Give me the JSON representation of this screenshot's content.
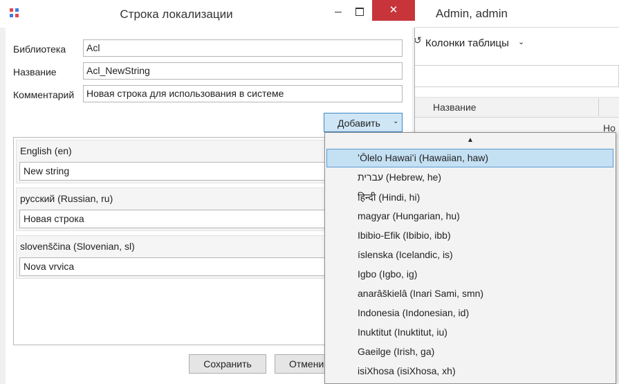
{
  "background_window": {
    "title": "Admin, admin",
    "toolbar_button": "Колонки таблицы",
    "grid_header": "Название",
    "grid_cell": "Но"
  },
  "dialog": {
    "title": "Строка локализации",
    "close_glyph": "✕",
    "fields": {
      "library_label": "Библиотека",
      "library_value": "Acl",
      "name_label": "Название",
      "name_value": "Acl_NewString",
      "comment_label": "Комментарий",
      "comment_value": "Новая строка для использования в системе"
    },
    "add_button": "Добавить",
    "languages": [
      {
        "name": "English (en)",
        "value": "New string"
      },
      {
        "name": "русский (Russian, ru)",
        "value": "Новая строка"
      },
      {
        "name": "slovenščina (Slovenian, sl)",
        "value": "Nova vrvica"
      }
    ],
    "save_button": "Сохранить",
    "cancel_button": "Отмени"
  },
  "dropdown": {
    "items": [
      "ʻŌlelo Hawaiʻi (Hawaiian, haw)",
      "עברית (Hebrew, he)",
      "हिन्दी (Hindi, hi)",
      "magyar (Hungarian, hu)",
      "Ibibio-Efik (Ibibio, ibb)",
      "íslenska (Icelandic, is)",
      "Igbo (Igbo, ig)",
      "anarâškielâ (Inari Sami, smn)",
      "Indonesia (Indonesian, id)",
      "Inuktitut (Inuktitut, iu)",
      "Gaeilge (Irish, ga)",
      "isiXhosa (isiXhosa, xh)"
    ],
    "selected_index": 0
  },
  "icons": {
    "app_icon_colors": [
      "#e5484d",
      "#3d7fe0",
      "#3d7fe0",
      "#e5484d"
    ]
  }
}
